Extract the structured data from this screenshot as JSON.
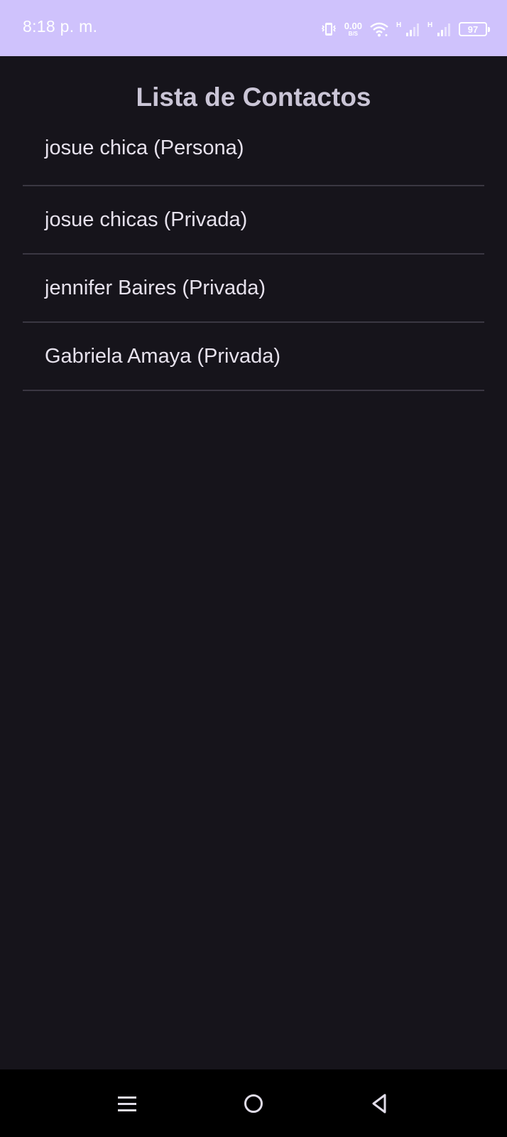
{
  "status_bar": {
    "time": "8:18 p. m.",
    "net_speed_value": "0.00",
    "net_speed_unit": "B/S",
    "network_label_1": "H",
    "network_label_2": "H",
    "battery_level": "97",
    "icons": [
      "vibrate-icon",
      "wifi-icon",
      "signal-icon",
      "signal-icon",
      "battery-icon"
    ]
  },
  "page": {
    "title": "Lista de Contactos"
  },
  "contacts": [
    {
      "label": "josue chica (Persona)"
    },
    {
      "label": "josue chicas (Privada)"
    },
    {
      "label": "jennifer Baires (Privada)"
    },
    {
      "label": "Gabriela Amaya (Privada)"
    }
  ],
  "nav_bar": {
    "icons": [
      "menu-icon",
      "home-icon",
      "back-icon"
    ]
  },
  "colors": {
    "status_bar_bg": "#cfc2fc",
    "background": "#16141b",
    "title_text": "#cac5d6",
    "item_text": "#e6e1ec",
    "divider": "#3a3742",
    "nav_bar_bg": "#000000"
  }
}
